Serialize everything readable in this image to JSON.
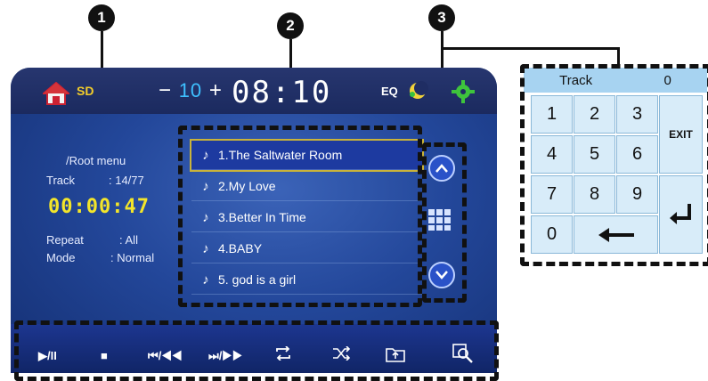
{
  "callouts": [
    "1",
    "2",
    "3"
  ],
  "status_bar": {
    "source": "SD",
    "volume_minus": "−",
    "volume": "10",
    "volume_plus": "+",
    "clock": "08:10",
    "eq_label": "EQ"
  },
  "info": {
    "path": "/Root menu",
    "track_label": "Track",
    "track_value": ": 14/77",
    "elapsed": "00:00:47",
    "repeat_label": "Repeat",
    "repeat_value": ": All",
    "mode_label": "Mode",
    "mode_value": ": Normal"
  },
  "playlist": [
    {
      "title": "1.The Saltwater Room",
      "selected": true
    },
    {
      "title": "2.My Love",
      "selected": false
    },
    {
      "title": "3.Better In Time",
      "selected": false
    },
    {
      "title": "4.BABY",
      "selected": false
    },
    {
      "title": "5. god is a girl",
      "selected": false
    }
  ],
  "controls": [
    "▶/II",
    "■",
    "⏮/◀◀",
    "⏭/▶▶",
    "repeat",
    "shuffle",
    "folder-up",
    "search"
  ],
  "keypad": {
    "title": "Track",
    "value": "0",
    "keys": [
      "1",
      "2",
      "3",
      "4",
      "5",
      "6",
      "7",
      "8",
      "9",
      "0"
    ],
    "exit": "EXIT"
  },
  "colors": {
    "screen_blue": "#23479a",
    "time_yellow": "#f3e52a",
    "keypad_header": "#a7d3f1",
    "key_bg": "#d8ecf9"
  }
}
